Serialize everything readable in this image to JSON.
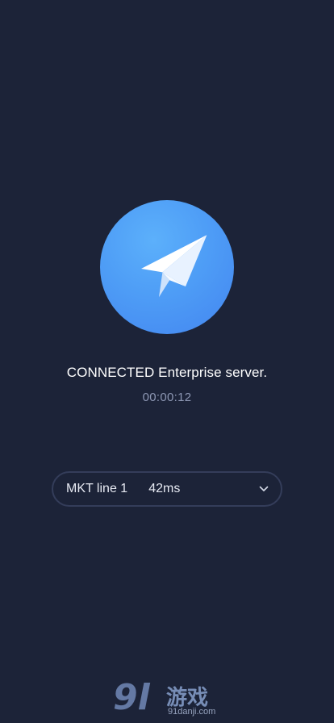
{
  "status": {
    "connection_label": "CONNECTED Enterprise server.",
    "timer": "00:00:12"
  },
  "server": {
    "name": "MKT line 1",
    "latency": "42ms"
  },
  "connect_button": {
    "icon": "paper-plane-icon"
  },
  "watermark": {
    "logo": "9l",
    "chinese": "游戏",
    "url": "91danji.com"
  },
  "colors": {
    "background": "#1c2338",
    "accent": "#4e9df6",
    "muted_text": "#8d97b3",
    "border": "#343d5a"
  }
}
